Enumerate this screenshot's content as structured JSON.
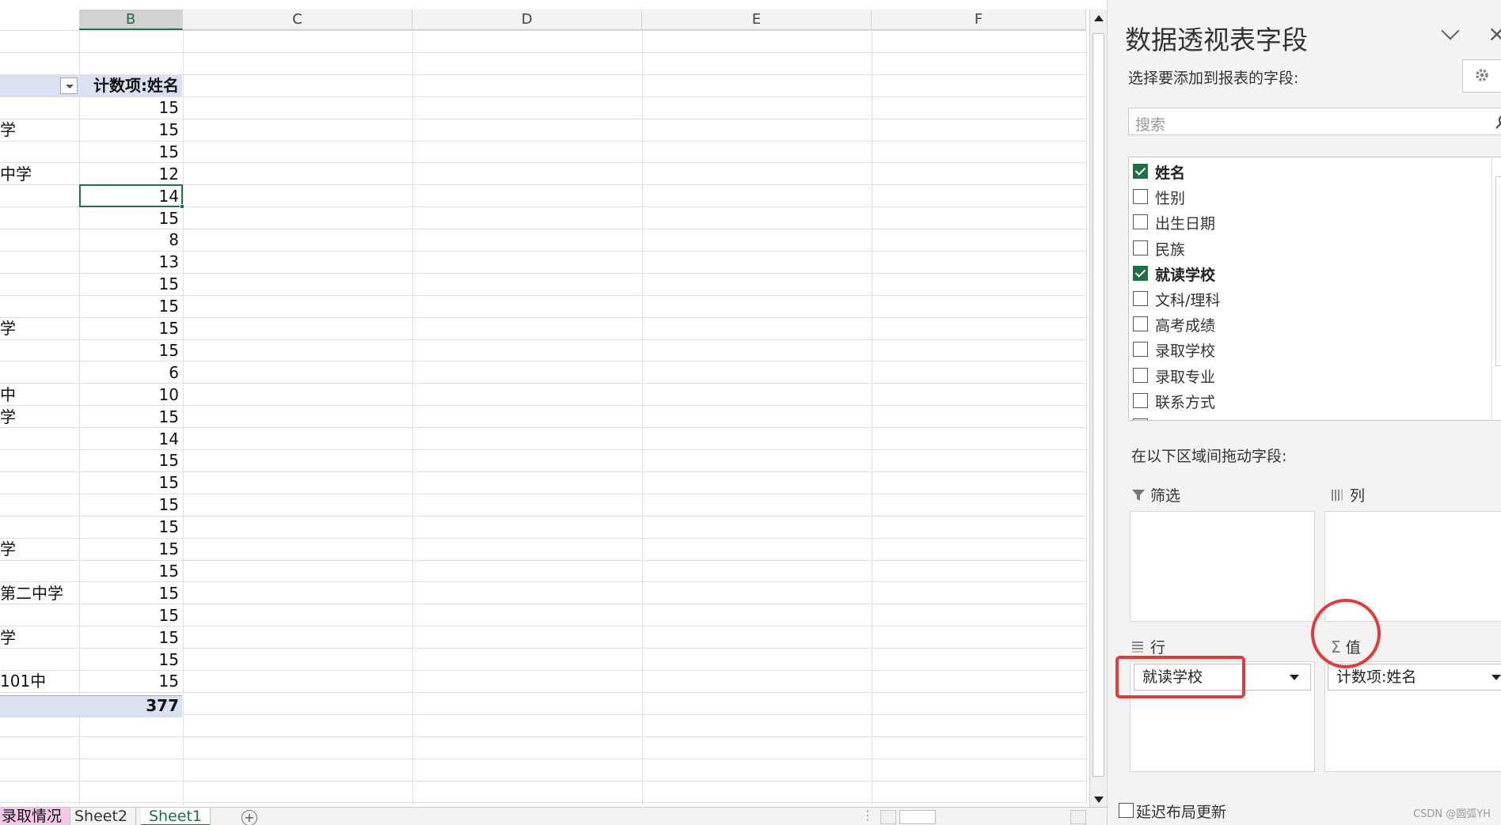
{
  "spreadsheet": {
    "columns": [
      "B",
      "C",
      "D",
      "E",
      "F"
    ],
    "pivot_header": "计数项:姓名",
    "rows": [
      {
        "label": "",
        "value": "15"
      },
      {
        "label": "学",
        "value": "15"
      },
      {
        "label": "",
        "value": "15"
      },
      {
        "label": "中学",
        "value": "12"
      },
      {
        "label": "",
        "value": "14"
      },
      {
        "label": "",
        "value": "15"
      },
      {
        "label": "",
        "value": "8"
      },
      {
        "label": "",
        "value": "13"
      },
      {
        "label": "",
        "value": "15"
      },
      {
        "label": "",
        "value": "15"
      },
      {
        "label": "学",
        "value": "15"
      },
      {
        "label": "",
        "value": "15"
      },
      {
        "label": "",
        "value": "6"
      },
      {
        "label": "中",
        "value": "10"
      },
      {
        "label": "学",
        "value": "15"
      },
      {
        "label": "",
        "value": "14"
      },
      {
        "label": "",
        "value": "15"
      },
      {
        "label": "",
        "value": "15"
      },
      {
        "label": "",
        "value": "15"
      },
      {
        "label": "",
        "value": "15"
      },
      {
        "label": "学",
        "value": "15"
      },
      {
        "label": "",
        "value": "15"
      },
      {
        "label": "第二中学",
        "value": "15"
      },
      {
        "label": "",
        "value": "15"
      },
      {
        "label": "学",
        "value": "15"
      },
      {
        "label": "",
        "value": "15"
      },
      {
        "label": "101中",
        "value": "15"
      }
    ],
    "total": "377",
    "selected_row_index": 4
  },
  "sheet_tabs": {
    "tabs": [
      "录取情况",
      "Sheet2",
      "Sheet1"
    ],
    "active": "Sheet1",
    "add_symbol": "+"
  },
  "pivot_pane": {
    "title": "数据透视表字段",
    "subtitle": "选择要添加到报表的字段:",
    "search_placeholder": "搜索",
    "fields": [
      {
        "label": "姓名",
        "checked": true
      },
      {
        "label": "性别",
        "checked": false
      },
      {
        "label": "出生日期",
        "checked": false
      },
      {
        "label": "民族",
        "checked": false
      },
      {
        "label": "就读学校",
        "checked": true
      },
      {
        "label": "文科/理科",
        "checked": false
      },
      {
        "label": "高考成绩",
        "checked": false
      },
      {
        "label": "录取学校",
        "checked": false
      },
      {
        "label": "录取专业",
        "checked": false
      },
      {
        "label": "联系方式",
        "checked": false
      },
      {
        "label": "备注",
        "checked": false
      }
    ],
    "drag_label": "在以下区域间拖动字段:",
    "areas": {
      "filter": "筛选",
      "columns": "列",
      "rows": "行",
      "values": "值",
      "rows_chip": "就读学校",
      "values_chip": "计数项:姓名"
    },
    "defer_label": "延迟布局更新",
    "watermark": "CSDN @圆弧YH"
  },
  "colors": {
    "accent": "#217346",
    "pivot_band": "#d9e1f2",
    "highlight": "#e23b3b",
    "tab_pink": "#f8c8ec"
  }
}
